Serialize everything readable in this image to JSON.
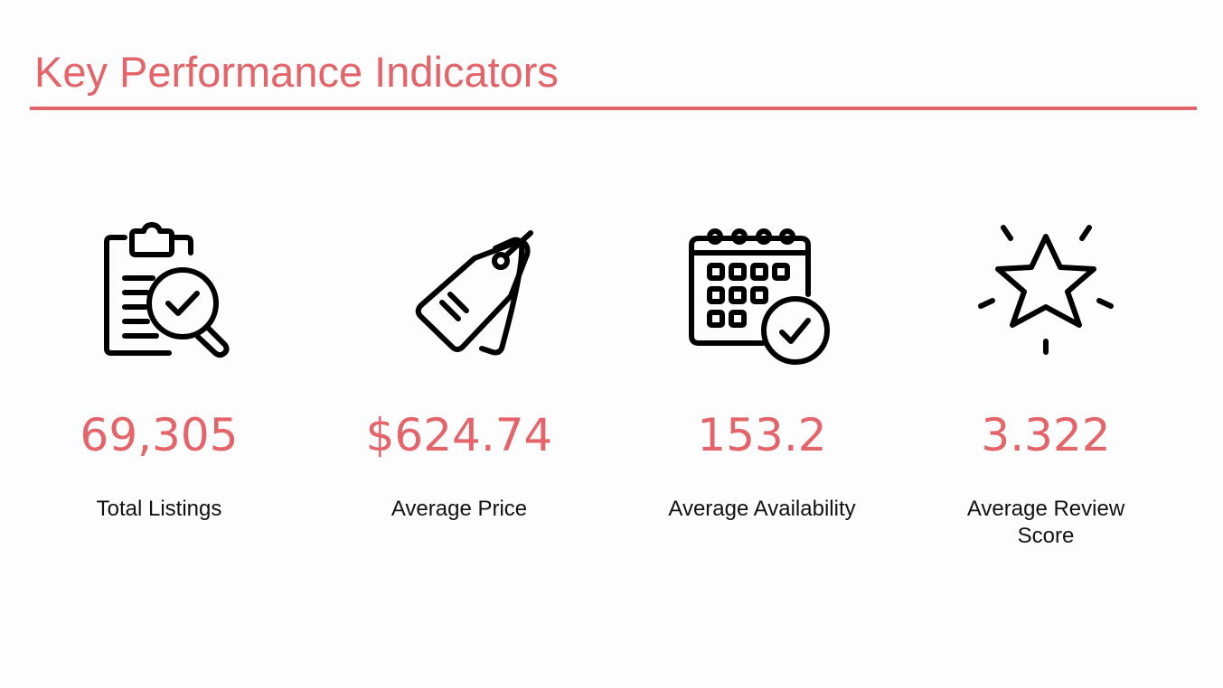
{
  "header": {
    "title": "Key Performance Indicators"
  },
  "colors": {
    "accent": "#e56469",
    "text": "#111111",
    "icon": "#000000"
  },
  "kpis": [
    {
      "icon": "clipboard-search-icon",
      "value": "69,305",
      "label": "Total Listings"
    },
    {
      "icon": "price-tag-icon",
      "value": "$624.74",
      "label": "Average Price"
    },
    {
      "icon": "calendar-check-icon",
      "value": "153.2",
      "label": "Average Availability"
    },
    {
      "icon": "star-sparkle-icon",
      "value": "3.322",
      "label": "Average Review Score"
    }
  ]
}
